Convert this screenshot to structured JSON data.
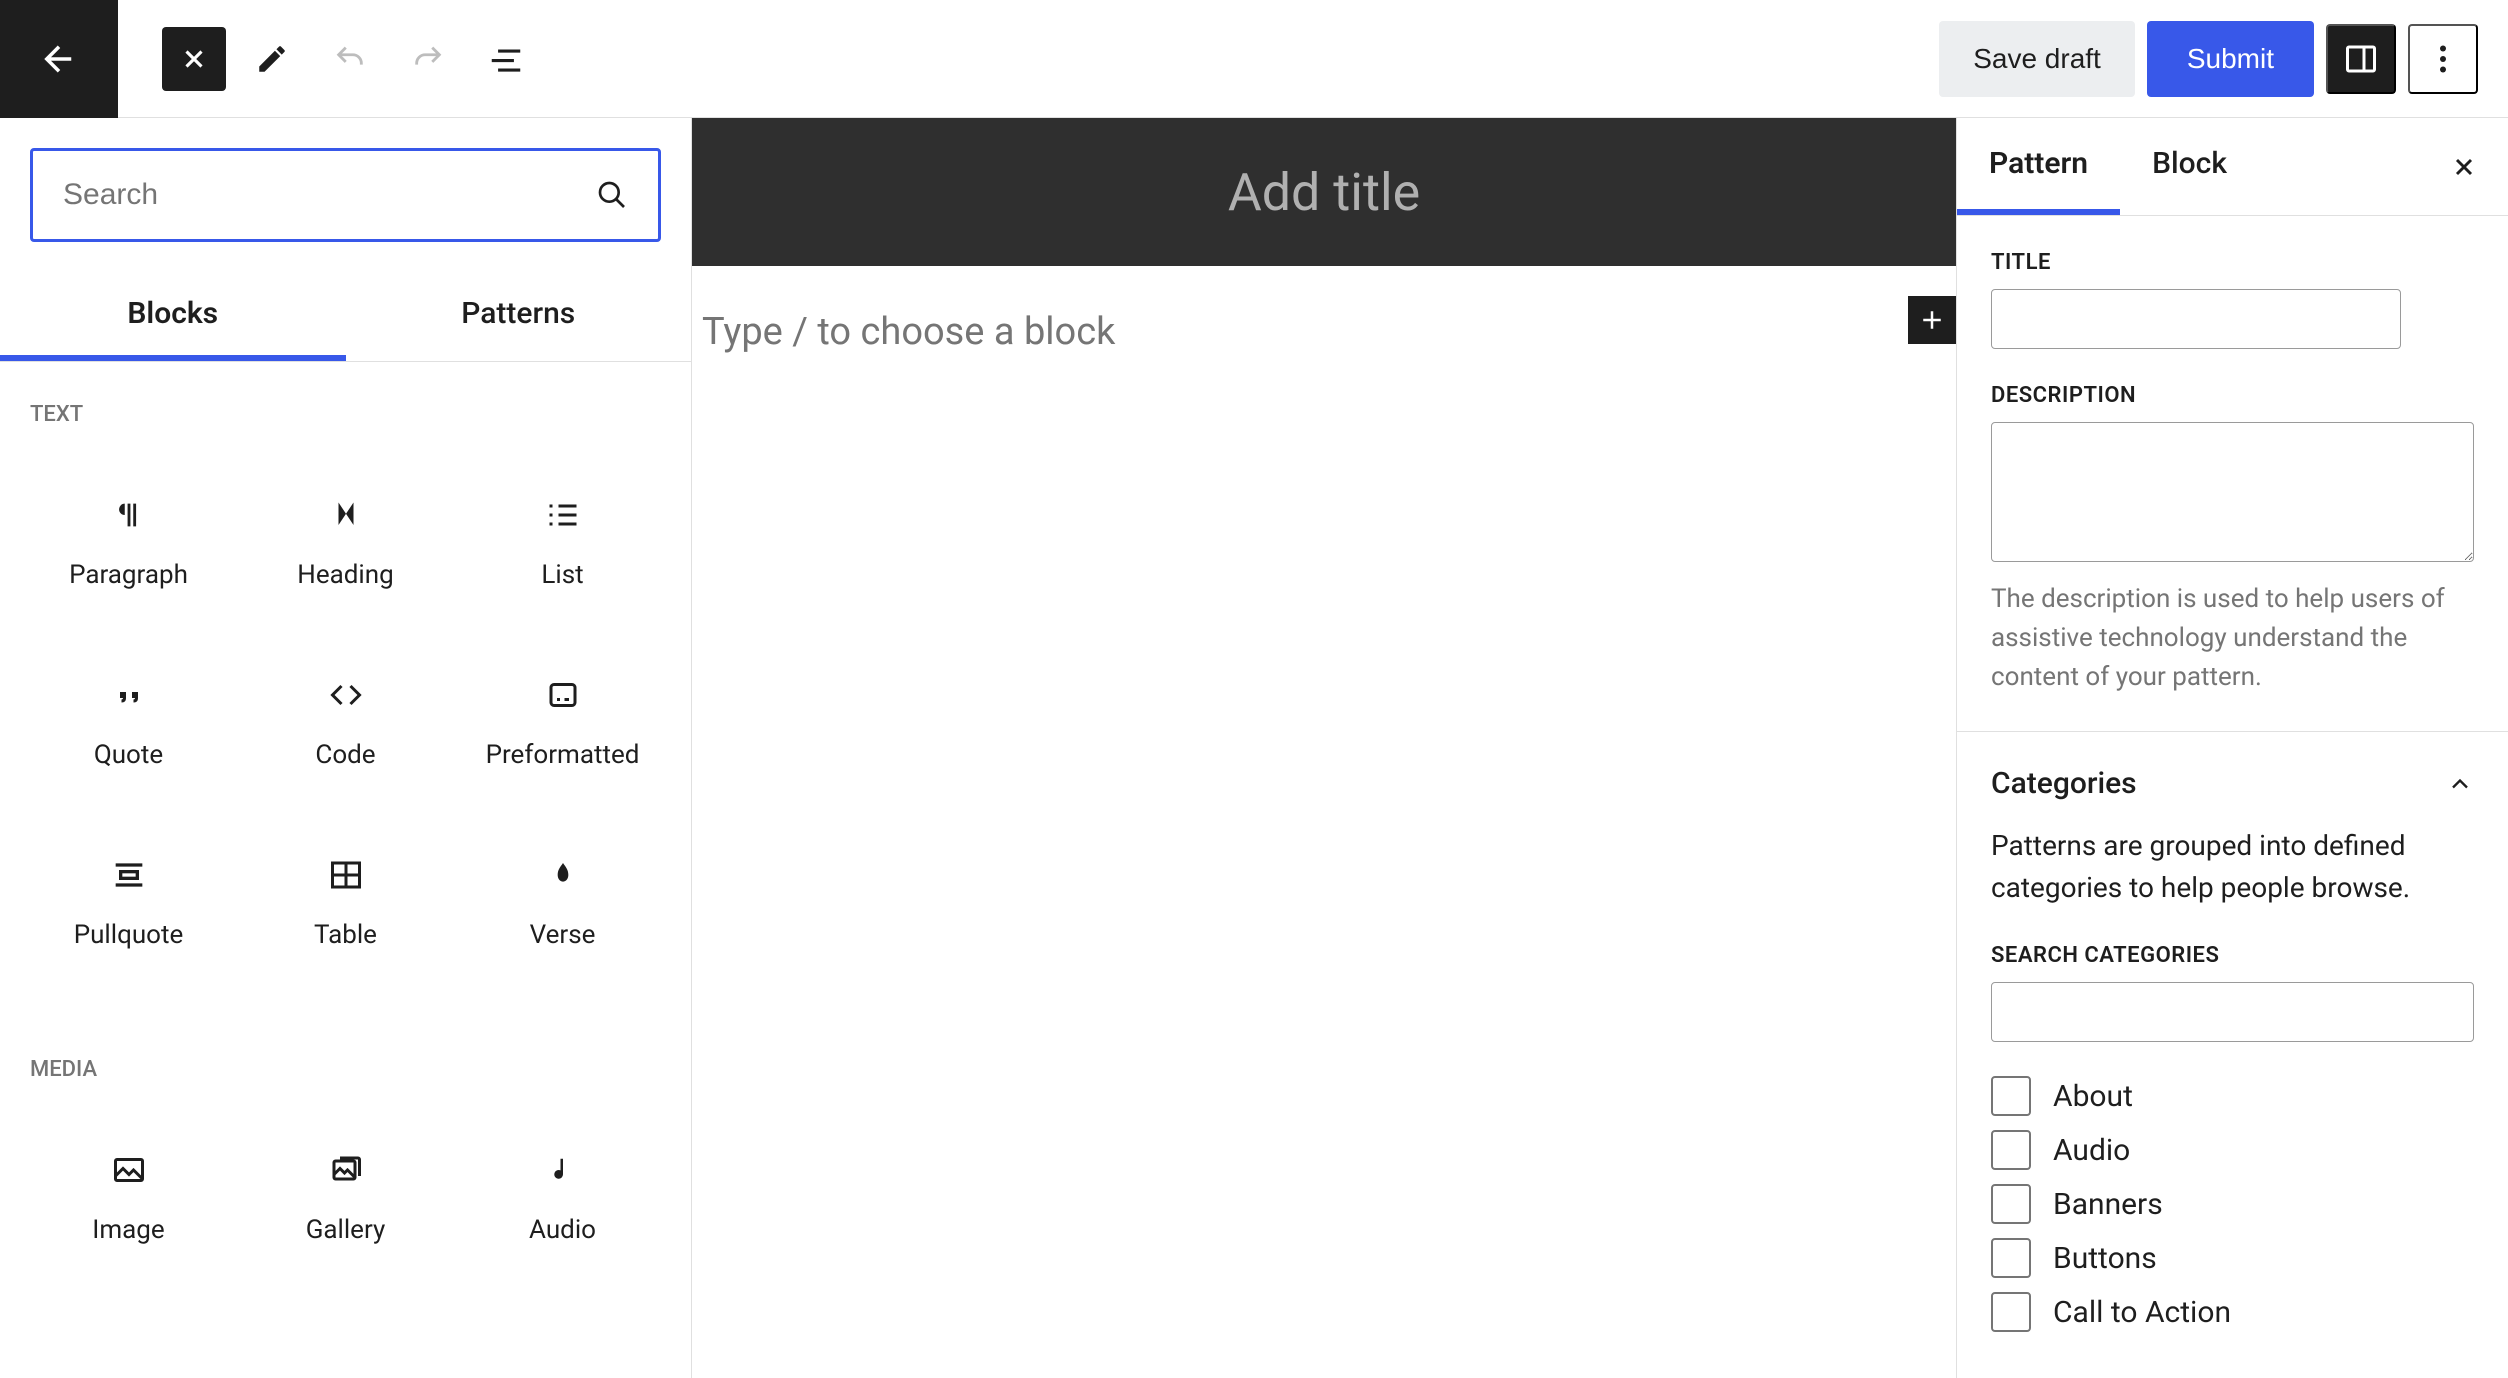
{
  "toolbar": {
    "save_draft": "Save draft",
    "submit": "Submit"
  },
  "inserter": {
    "search_placeholder": "Search",
    "tabs": {
      "blocks": "Blocks",
      "patterns": "Patterns"
    },
    "sections": {
      "text": {
        "label": "TEXT",
        "items": [
          "Paragraph",
          "Heading",
          "List",
          "Quote",
          "Code",
          "Preformatted",
          "Pullquote",
          "Table",
          "Verse"
        ]
      },
      "media": {
        "label": "MEDIA",
        "items": [
          "Image",
          "Gallery",
          "Audio"
        ]
      }
    }
  },
  "canvas": {
    "title_placeholder": "Add title",
    "type_prompt": "Type / to choose a block"
  },
  "settings": {
    "tabs": {
      "pattern": "Pattern",
      "block": "Block"
    },
    "title_label": "TITLE",
    "description_label": "DESCRIPTION",
    "description_help": "The description is used to help users of assistive technology understand the content of your pattern.",
    "categories_label": "Categories",
    "categories_desc": "Patterns are grouped into defined categories to help people browse.",
    "search_categories_label": "SEARCH CATEGORIES",
    "categories": [
      "About",
      "Audio",
      "Banners",
      "Buttons",
      "Call to Action"
    ]
  }
}
